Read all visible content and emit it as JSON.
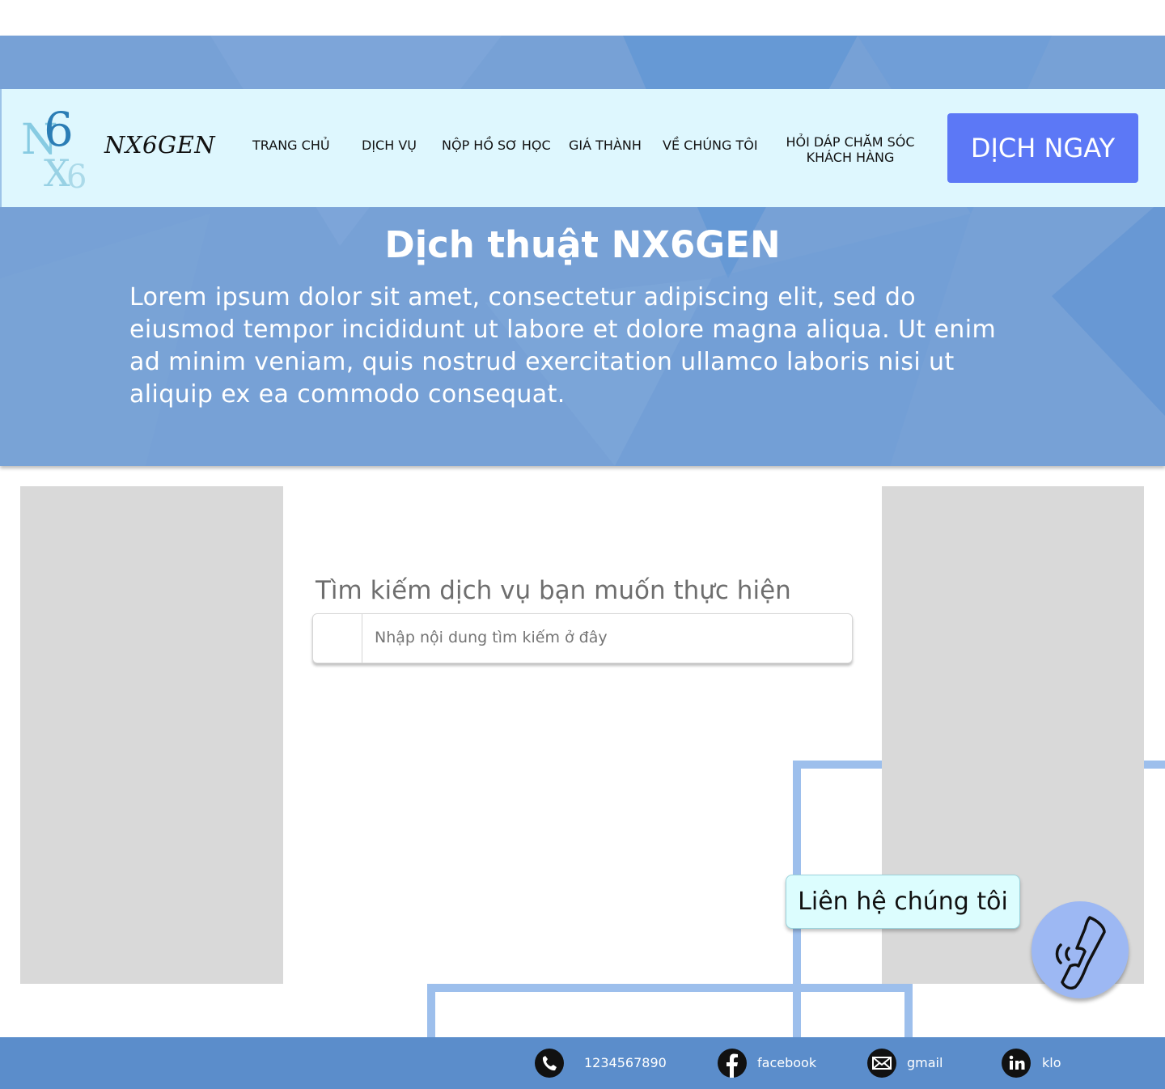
{
  "brand": {
    "name": "NX6GEN",
    "logo_text": "N6X6"
  },
  "nav": {
    "items": [
      {
        "label": "TRANG CHỦ"
      },
      {
        "label": "DỊCH VỤ"
      },
      {
        "label": "NỘP HỒ SƠ HỌC"
      },
      {
        "label": "GIÁ THÀNH"
      },
      {
        "label": "VỀ CHÚNG TÔI"
      },
      {
        "label": "HỎI DÁP CHĂM SÓC KHÁCH HÀNG"
      }
    ],
    "cta_label": "DỊCH NGAY"
  },
  "hero": {
    "title": "Dịch thuật NX6GEN",
    "text": "Lorem ipsum dolor sit amet, consectetur adipiscing elit, sed do eiusmod tempor incididunt ut labore et dolore magna aliqua. Ut enim ad minim veniam, quis nostrud exercitation ullamco laboris nisi ut aliquip ex ea commodo consequat."
  },
  "search": {
    "label": "Tìm kiếm dịch vụ bạn muốn thực hiện",
    "placeholder": "Nhập nội dung tìm kiếm ở đây"
  },
  "contact": {
    "bubble_label": "Liên hệ chúng tôi"
  },
  "footer": {
    "phone": "1234567890",
    "facebook": "facebook",
    "gmail": "gmail",
    "linkedin": "klo"
  },
  "colors": {
    "hero_bg": "#77a1d6",
    "navbar_bg": "#def7fe",
    "cta_bg": "#5c78f6",
    "footer_bg": "#5b8dcb",
    "placeholder_gray": "#d9d9d9",
    "accent_line": "#9dbfec"
  },
  "icons": {
    "search_cell": "empty-icon-slot",
    "fab": "phone-call-icon",
    "footer": [
      "phone-icon",
      "facebook-icon",
      "mail-icon",
      "linkedin-icon"
    ]
  }
}
